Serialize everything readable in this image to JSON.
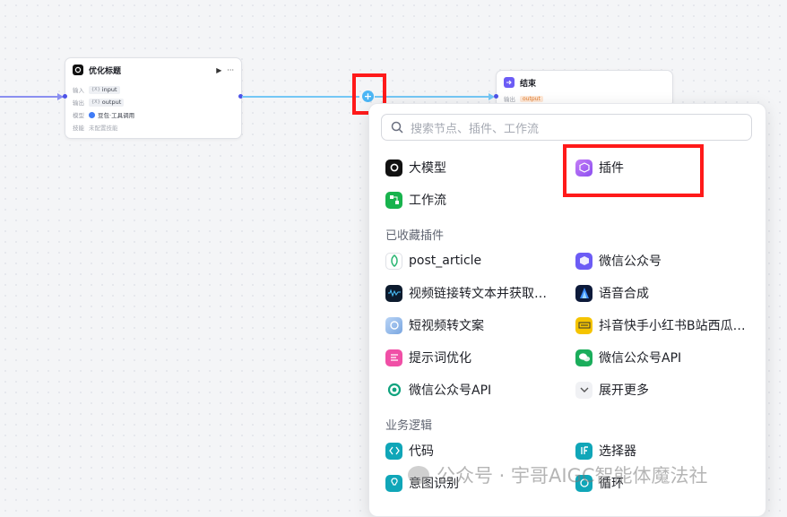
{
  "canvas": {
    "node1": {
      "title": "优化标题",
      "play": "▶",
      "more": "···",
      "input_label": "输入",
      "input_value": "input",
      "output_label": "输出",
      "output_value": "output",
      "model_label": "模型",
      "model_value": "豆包·工具调用",
      "skill_label": "技能",
      "skill_value": "未配置技能"
    },
    "node2": {
      "title": "结束",
      "sub_label": "输出",
      "sub_value": "output"
    },
    "plus": "+"
  },
  "panel": {
    "search_placeholder": "搜索节点、插件、工作流",
    "top_items": [
      {
        "label": "大模型",
        "icon": "llm-icon"
      },
      {
        "label": "插件",
        "icon": "plugin-cube-icon"
      },
      {
        "label": "工作流",
        "icon": "workflow-icon"
      }
    ],
    "favorites_title": "已收藏插件",
    "favorites": [
      {
        "label": "post_article",
        "icon": "leaf-icon"
      },
      {
        "label": "微信公众号",
        "icon": "cube-icon"
      },
      {
        "label": "视频链接转文本并获取…",
        "icon": "video-icon"
      },
      {
        "label": "语音合成",
        "icon": "audio-icon"
      },
      {
        "label": "短视频转文案",
        "icon": "clip-icon"
      },
      {
        "label": "抖音快手小红书B站西瓜…",
        "icon": "ticket-icon"
      },
      {
        "label": "提示词优化",
        "icon": "prompt-icon"
      },
      {
        "label": "微信公众号API",
        "icon": "wechat-icon"
      },
      {
        "label": "微信公众号API",
        "icon": "openai-icon"
      },
      {
        "label": "展开更多",
        "icon": "chevron-down-icon"
      }
    ],
    "logic_title": "业务逻辑",
    "logic": [
      {
        "label": "代码",
        "icon": "code-icon"
      },
      {
        "label": "选择器",
        "icon": "if-icon"
      },
      {
        "label": "意图识别",
        "icon": "intent-icon"
      },
      {
        "label": "循环",
        "icon": "loop-icon"
      }
    ]
  },
  "watermark": "公众号 · 宇哥AIGC智能体魔法社",
  "colors": {
    "accent": "#4d53e8",
    "edge": "#74c7f5",
    "highlight": "#ff1a1a"
  }
}
